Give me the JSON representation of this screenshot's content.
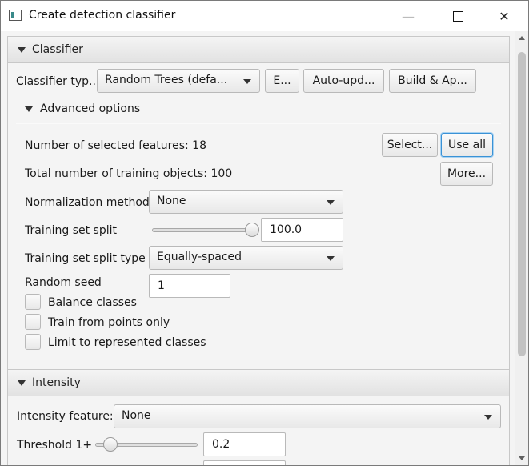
{
  "window": {
    "title": "Create detection classifier",
    "controls": {
      "minimize": "—",
      "close": "✕"
    }
  },
  "classifier_section": {
    "header": "Classifier",
    "type_label": "Classifier typ...",
    "type_value": "Random Trees (defa...",
    "edit_button": "E...",
    "auto_update_button": "Auto-upd...",
    "build_apply_button": "Build & Ap...",
    "advanced": {
      "header": "Advanced options",
      "selected_features_text": "Number of selected features: 18",
      "select_button": "Select...",
      "use_all_button": "Use all",
      "training_objects_text": "Total number of training objects: 100",
      "more_button": "More...",
      "normalization_label": "Normalization method",
      "normalization_value": "None",
      "split_label": "Training set split",
      "split_value": "100.0",
      "split_level": 1.0,
      "split_type_label": "Training set split type",
      "split_type_value": "Equally-spaced",
      "seed_label": "Random seed",
      "seed_value": "1",
      "balance_classes_label": "Balance classes",
      "balance_classes_checked": false,
      "train_points_label": "Train from points only",
      "train_points_checked": false,
      "limit_classes_label": "Limit to represented classes",
      "limit_classes_checked": false
    }
  },
  "intensity_section": {
    "header": "Intensity",
    "feature_label": "Intensity feature:",
    "feature_value": "None",
    "threshold1_label": "Threshold 1+",
    "threshold1_value": "0.2"
  }
}
